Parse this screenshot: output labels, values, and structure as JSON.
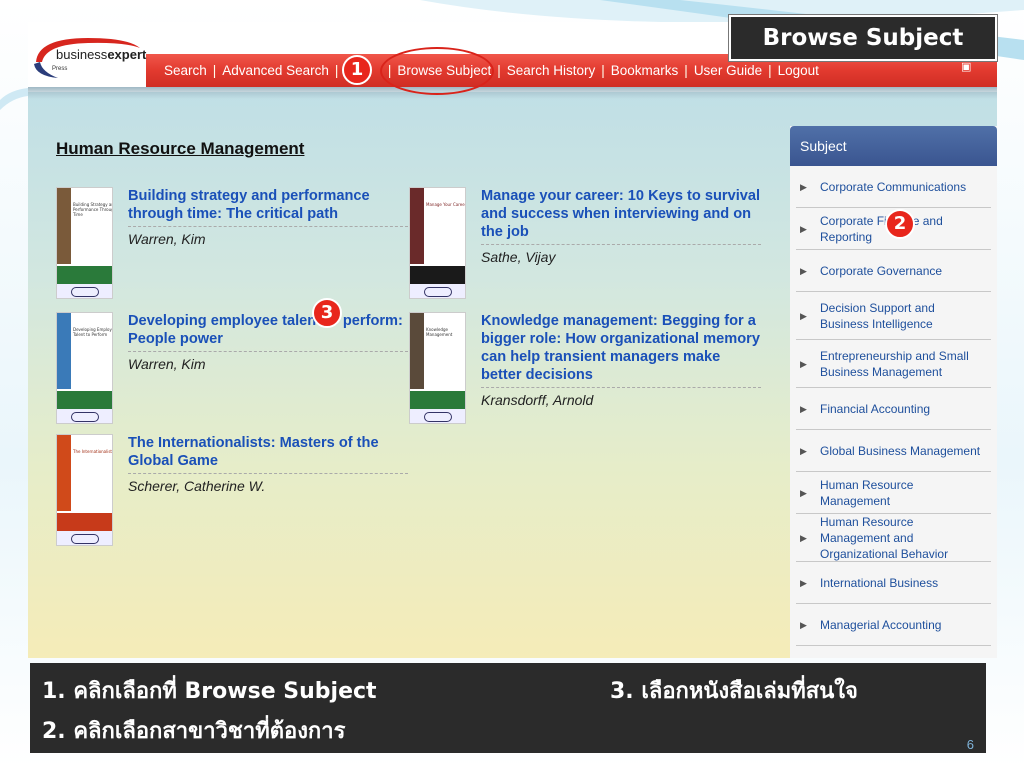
{
  "callout": {
    "title": "Browse Subject"
  },
  "logo": {
    "brand_light": "business",
    "brand_bold": "expert",
    "press": "Press"
  },
  "nav": {
    "items": [
      "Search",
      "Advanced Search",
      "Br",
      "Browse Subject",
      "Search History",
      "Bookmarks",
      "User Guide",
      "Logout"
    ]
  },
  "section_title": "Human Resource Management",
  "books": [
    {
      "title": "Building strategy and performance through time: The critical path",
      "author": "Warren, Kim",
      "cover_title": "Building Strategy and Performance Through Time",
      "accent": "#2a7a3a"
    },
    {
      "title": "Manage your career: 10 Keys to survival and success when interviewing and on the job",
      "author": "Sathe, Vijay",
      "cover_title": "Manage Your Career",
      "accent": "#7a1f1f"
    },
    {
      "title": "Developing employee talent to perform: People power",
      "author": "Warren, Kim",
      "cover_title": "Developing Employee Talent to Perform",
      "accent": "#2a7a3a"
    },
    {
      "title": "Knowledge management: Begging for a bigger role: How organizational memory can help transient managers make better decisions",
      "author": "Kransdorff, Arnold",
      "cover_title": "Knowledge Management",
      "accent": "#2a7a3a"
    },
    {
      "title": "The Internationalists: Masters of the Global Game",
      "author": "Scherer, Catherine W.",
      "cover_title": "The Internationalists",
      "accent": "#c73a1a"
    }
  ],
  "sidebar": {
    "heading": "Subject",
    "items": [
      "Corporate Communications",
      "Corporate Finance and Reporting",
      "Corporate Governance",
      "Decision Support and Business Intelligence",
      "Entrepreneurship and Small Business Management",
      "Financial Accounting",
      "Global Business Management",
      "Human Resource Management",
      "Human Resource Management and Organizational Behavior",
      "International Business",
      "Managerial Accounting"
    ]
  },
  "markers": {
    "m1": "1",
    "m2": "2",
    "m3": "3"
  },
  "instructions": {
    "step1": "1. คลิกเลือกที่ Browse Subject",
    "step2": "2. คลิกเลือกสาขาวิชาที่ต้องการ",
    "step3": "3. เลือกหนังสือเล่มที่สนใจ"
  },
  "slide_number": "6",
  "colors": {
    "nav_red": "#e23a2f",
    "link_blue": "#1a50b8",
    "marker_red": "#e8261c",
    "panel_dark": "#2b2b2b"
  }
}
